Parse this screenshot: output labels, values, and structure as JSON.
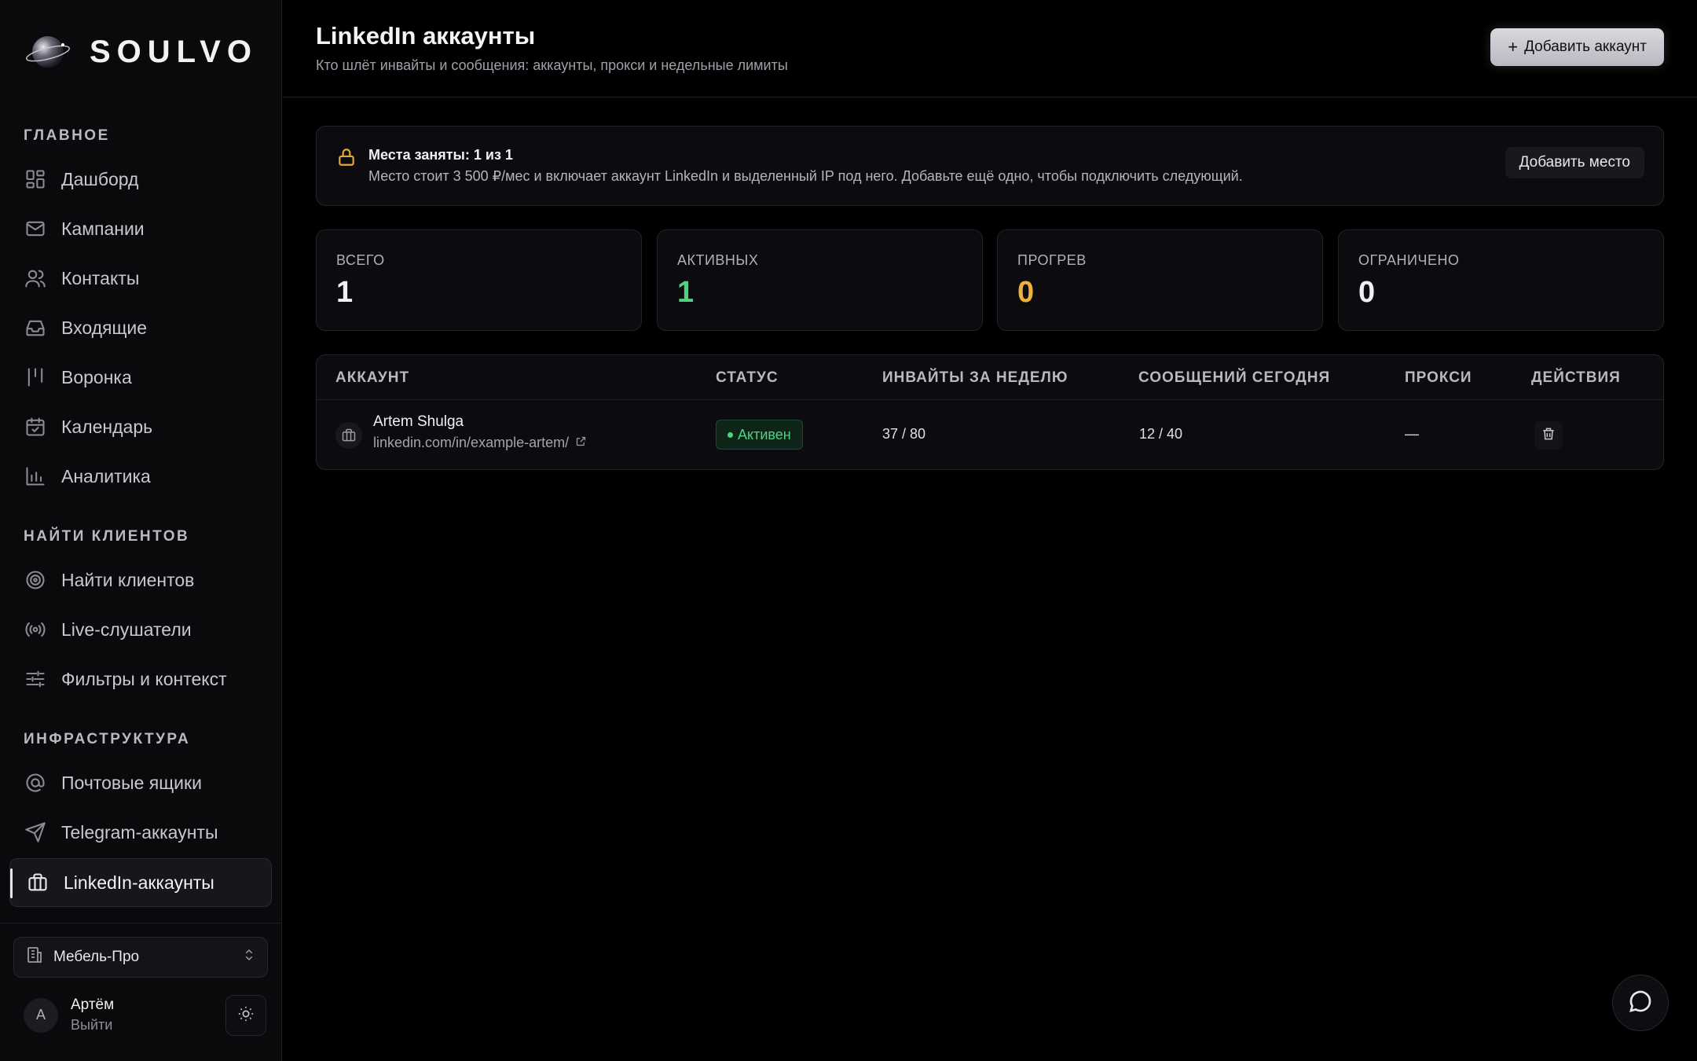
{
  "brand": {
    "name": "SOULVO"
  },
  "sidebar": {
    "sections": [
      {
        "label": "ГЛАВНОЕ"
      },
      {
        "label": "НАЙТИ КЛИЕНТОВ"
      },
      {
        "label": "ИНФРАСТРУКТУРА"
      }
    ],
    "items": [
      {
        "label": "Дашборд",
        "icon": "dashboard-icon"
      },
      {
        "label": "Кампании",
        "icon": "mail-icon"
      },
      {
        "label": "Контакты",
        "icon": "users-icon"
      },
      {
        "label": "Входящие",
        "icon": "inbox-icon"
      },
      {
        "label": "Воронка",
        "icon": "funnel-icon"
      },
      {
        "label": "Календарь",
        "icon": "calendar-icon"
      },
      {
        "label": "Аналитика",
        "icon": "chart-icon"
      },
      {
        "label": "Найти клиентов",
        "icon": "target-icon"
      },
      {
        "label": "Live-слушатели",
        "icon": "broadcast-icon"
      },
      {
        "label": "Фильтры и контекст",
        "icon": "sliders-icon"
      },
      {
        "label": "Почтовые ящики",
        "icon": "at-icon"
      },
      {
        "label": "Telegram-аккаунты",
        "icon": "send-icon"
      },
      {
        "label": "LinkedIn-аккаунты",
        "icon": "briefcase-icon",
        "active": true
      }
    ],
    "workspace": {
      "name": "Мебель-Про"
    },
    "user": {
      "initial": "А",
      "name": "Артём",
      "logout": "Выйти"
    }
  },
  "header": {
    "title": "LinkedIn аккаунты",
    "subtitle": "Кто шлёт инвайты и сообщения: аккаунты, прокси и недельные лимиты",
    "add_button": "Добавить аккаунт",
    "add_button_icon": "+"
  },
  "notice": {
    "title": "Места заняты: 1 из 1",
    "text": "Место стоит 3 500 ₽/мес и включает аккаунт LinkedIn и выделенный IP под него. Добавьте ещё одно, чтобы подключить следующий.",
    "button": "Добавить место",
    "icon": "lock-icon",
    "icon_color": "#e4a73c"
  },
  "stats": [
    {
      "label": "ВСЕГО",
      "value": "1",
      "color": "#f0f0f2"
    },
    {
      "label": "АКТИВНЫХ",
      "value": "1",
      "color": "#4fd37e"
    },
    {
      "label": "ПРОГРЕВ",
      "value": "0",
      "color": "#f0b03a"
    },
    {
      "label": "ОГРАНИЧЕНО",
      "value": "0",
      "color": "#f0f0f2"
    }
  ],
  "table": {
    "headers": [
      "АККАУНТ",
      "СТАТУС",
      "ИНВАЙТЫ ЗА НЕДЕЛЮ",
      "СООБЩЕНИЙ СЕГОДНЯ",
      "ПРОКСИ",
      "ДЕЙСТВИЯ"
    ],
    "rows": [
      {
        "name": "Artem Shulga",
        "url": "linkedin.com/in/example-artem/",
        "status": "Активен",
        "invites": "37 / 80",
        "messages": "12 / 40",
        "proxy": "—"
      }
    ]
  },
  "colors": {
    "accent_green": "#4fd37e",
    "accent_orange": "#f0b03a"
  }
}
